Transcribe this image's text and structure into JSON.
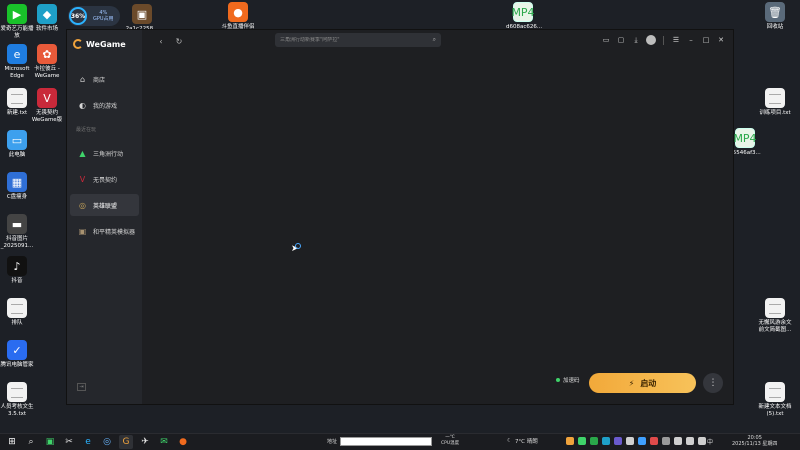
{
  "desktop": {
    "icons_left": [
      {
        "label": "爱奇艺万能播放",
        "glyph": "▶",
        "color": "#19c12a"
      },
      {
        "label": "Microsoft Edge",
        "glyph": "e",
        "color": "#1f7de0"
      },
      {
        "label": "新建.txt",
        "glyph": "",
        "color": "#f2f2f2"
      },
      {
        "label": "此电脑",
        "glyph": "▭",
        "color": "#3da0ee"
      },
      {
        "label": "C盘瘦身",
        "glyph": "▦",
        "color": "#2f6fd6"
      },
      {
        "label": "抖音图片 _2025091...",
        "glyph": "▬",
        "color": "#444"
      },
      {
        "label": "抖音",
        "glyph": "♪",
        "color": "#111"
      },
      {
        "label": "排队",
        "glyph": "",
        "color": "#f2f2f2"
      },
      {
        "label": "腾讯电脑管家",
        "glyph": "✓",
        "color": "#2a6cf0"
      },
      {
        "label": "人员考核文生 3.5.txt",
        "glyph": "",
        "color": "#f2f2f2"
      }
    ],
    "icons_col2": [
      {
        "label": "软件市场",
        "glyph": "◆",
        "color": "#1ea0c8"
      },
      {
        "label": "卡拉彼丘 -WeGame",
        "glyph": "✿",
        "color": "#e85a3a"
      },
      {
        "label": "无畏契约 WeGame版",
        "glyph": "V",
        "color": "#c9293a"
      }
    ],
    "icons_top": [
      {
        "label": "2a1c2258...",
        "glyph": "▣",
        "color": "#6b4a2a"
      },
      {
        "label": "斗鱼直播伴侣",
        "glyph": "●",
        "color": "#f06a1e"
      },
      {
        "label": "d608ac626...",
        "glyph": "MP4",
        "color": "#e8f5e8"
      },
      {
        "label": "回收站",
        "glyph": "🗑",
        "color": "#5a6a7a"
      }
    ],
    "icons_right": [
      {
        "label": "训练项目.txt",
        "glyph": "",
        "color": "#f2f2f2"
      },
      {
        "label": "15546af3...",
        "glyph": "MP4",
        "color": "#e8f5e8"
      },
      {
        "label": "无懈风游余文 前文简截图...",
        "glyph": "",
        "color": "#f2f2f2"
      },
      {
        "label": "新建文本文档 (5).txt",
        "glyph": "",
        "color": "#f2f2f2"
      }
    ],
    "gpu_widget": {
      "percent": "36%",
      "small_percent": "4%",
      "label": "GPU占用"
    }
  },
  "wegame": {
    "logo_text": "WeGame",
    "search_placeholder": "三角洲行动新赛季\"阿萨拉\"",
    "nav_main": [
      {
        "label": "商店",
        "glyph": "⌂"
      },
      {
        "label": "我的游戏",
        "glyph": "◐"
      }
    ],
    "recent_label": "最近在玩",
    "nav_games": [
      {
        "label": "三角洲行动",
        "glyph": "▲",
        "color": "#3fd36a",
        "active": false
      },
      {
        "label": "无畏契约",
        "glyph": "V",
        "color": "#c9293a",
        "active": false
      },
      {
        "label": "英雄联盟",
        "glyph": "◎",
        "color": "#c8a55a",
        "active": true
      },
      {
        "label": "和平精英模拟器",
        "glyph": "▣",
        "color": "#a89270",
        "active": false
      }
    ],
    "accelerator_label": "加速码",
    "launch_label": "启动"
  },
  "taskbar": {
    "address_label": "地址",
    "cpu_line1": "一℃",
    "cpu_line2": "CPU温度",
    "weather": "7°C 晴朗",
    "ime": "中",
    "time": "20:05",
    "date": "2025/11/13 星期四",
    "tray_colors": [
      "#f0a33c",
      "#3fd36a",
      "#2aa84a",
      "#1ea0c8",
      "#6a5acd",
      "#d0d0d0",
      "#3fa0ff",
      "#e04a4a",
      "#9a9a9a",
      "#cfcfcf",
      "#cfcfcf",
      "#cfcfcf"
    ]
  }
}
